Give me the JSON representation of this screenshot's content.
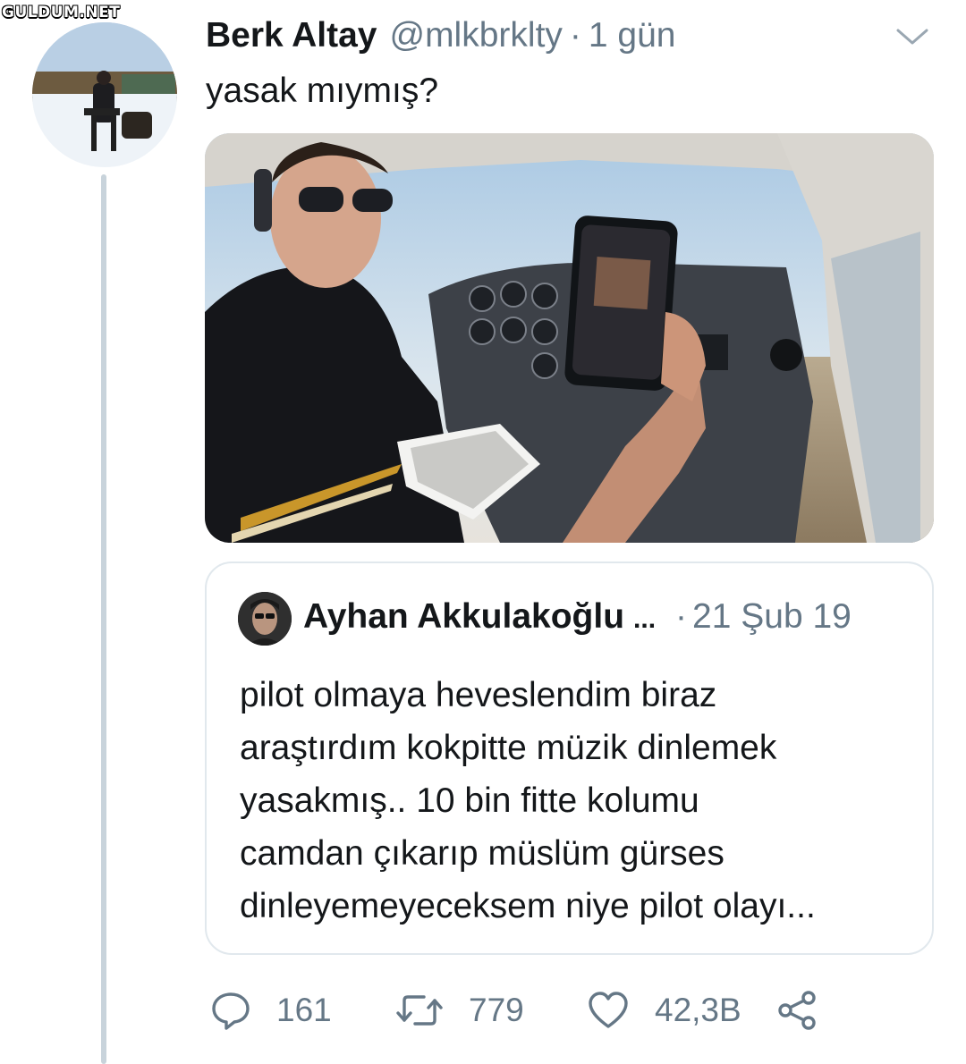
{
  "watermark": "GULDUM.NET",
  "tweet": {
    "author_name": "Berk Altay",
    "author_handle": "@mlkbrklty",
    "separator": "·",
    "time": "1 gün",
    "text": "yasak mıymış?"
  },
  "quoted_tweet": {
    "author_name": "Ayhan Akkulakoğlu",
    "name_truncation": "...",
    "separator": "·",
    "time": "21 Şub 19",
    "text_lines": [
      "pilot olmaya heveslendim biraz",
      "araştırdım kokpitte müzik dinlemek",
      "yasakmış.. 10 bin fitte kolumu",
      "camdan çıkarıp müslüm gürses",
      "dinleyemeyeceksem niye pilot olayı..."
    ]
  },
  "actions": {
    "reply_count": "161",
    "retweet_count": "779",
    "like_count": "42,3B"
  },
  "icons": {
    "menu": "chevron-down-icon",
    "reply": "speech-bubble-icon",
    "retweet": "retweet-arrows-icon",
    "like": "heart-icon",
    "share": "share-icon"
  },
  "colors": {
    "text_primary": "#14171a",
    "text_secondary": "#657786",
    "border": "#e1e8ed",
    "thread_line": "#c8d3db"
  }
}
